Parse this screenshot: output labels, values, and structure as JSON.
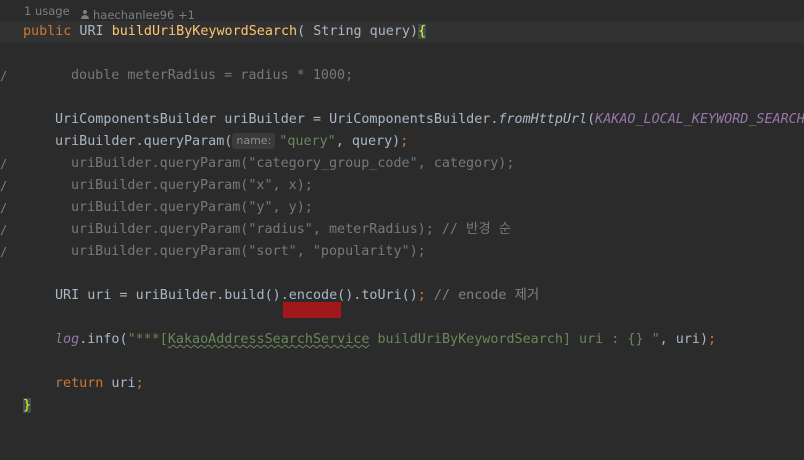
{
  "hint": {
    "usages": "1 usage",
    "author": "haechanlee96 +1"
  },
  "lines": {
    "l1": {
      "t1": "public",
      "t2": " URI ",
      "t3": "buildUriByKeywordSearch",
      "t4": "( String query)",
      "t5": "{"
    },
    "l2": {
      "mark": "/",
      "t1": "double meterRadius = radius * ",
      "t2": "1000",
      "t3": ";"
    },
    "l3": {
      "t1": "UriComponentsBuilder uriBuilder = UriComponentsBuilder.",
      "t2": "fromHttpUrl",
      "t3": "(",
      "t4": "KAKAO_LOCAL_KEYWORD_SEARCH_"
    },
    "l4": {
      "t1": "uriBuilder.queryParam(",
      "hint": "name:",
      "t2": "\"query\"",
      "t3": ", query)",
      "t4": ";"
    },
    "l5": {
      "mark": "/",
      "t1": "uriBuilder.queryParam(\"category_group_code\", category);"
    },
    "l6": {
      "mark": "/",
      "t1": "uriBuilder.queryParam(\"x\", x);"
    },
    "l7": {
      "mark": "/",
      "t1": "uriBuilder.queryParam(\"y\", y);"
    },
    "l8": {
      "mark": "/",
      "t1": "uriBuilder.queryParam(\"radius\", meterRadius); // 반경 순"
    },
    "l9": {
      "mark": "/",
      "t1": "uriBuilder.queryParam(\"sort\", \"popularity\");"
    },
    "l10": {
      "t1": "URI uri = uriBuilder.build().encode().toUri()",
      "t2": ";",
      "t3": " // encode 제거"
    },
    "l11": {
      "t1": "log",
      "t2": ".info(",
      "t3": "\"***[",
      "t4": "KakaoAddressSearchService",
      "t5": " buildUriByKeywordSearch] uri : {} \"",
      "t6": ", uri)",
      "t7": ";"
    },
    "l12": {
      "t1": "return",
      "t2": " uri",
      "t3": ";"
    },
    "l13": {
      "t1": "}"
    }
  }
}
